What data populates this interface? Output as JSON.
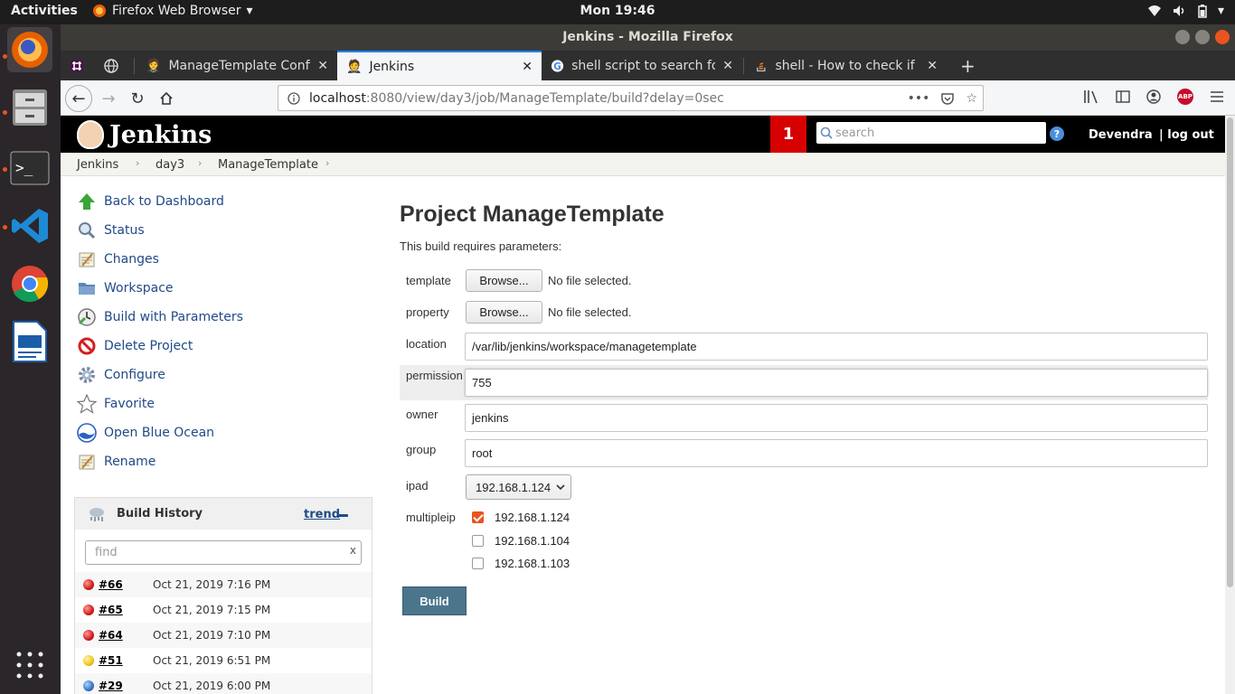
{
  "topbar": {
    "activities": "Activities",
    "app_name": "Firefox Web Browser",
    "clock": "Mon 19:46"
  },
  "window": {
    "title": "Jenkins - Mozilla Firefox"
  },
  "tabs": [
    {
      "label": "ManageTemplate Config",
      "icon": "jenkins-icon"
    },
    {
      "label": "Jenkins",
      "icon": "jenkins-icon"
    },
    {
      "label": "shell script to search for",
      "icon": "google-icon"
    },
    {
      "label": "shell - How to check if a f",
      "icon": "stackoverflow-icon"
    }
  ],
  "urlbar": {
    "host": "localhost",
    "path": ":8080/view/day3/job/ManageTemplate/build?delay=0sec"
  },
  "jenkins": {
    "brand": "Jenkins",
    "notification_count": "1",
    "search_placeholder": "search",
    "user": "Devendra",
    "logout": "| log out"
  },
  "breadcrumb": [
    "Jenkins",
    "day3",
    "ManageTemplate"
  ],
  "sidebar": {
    "tasks": [
      {
        "label": "Back to Dashboard",
        "icon": "up-arrow-icon"
      },
      {
        "label": "Status",
        "icon": "magnifier-icon"
      },
      {
        "label": "Changes",
        "icon": "notepad-icon"
      },
      {
        "label": "Workspace",
        "icon": "folder-icon"
      },
      {
        "label": "Build with Parameters",
        "icon": "clock-icon"
      },
      {
        "label": "Delete Project",
        "icon": "no-entry-icon"
      },
      {
        "label": "Configure",
        "icon": "gear-icon"
      },
      {
        "label": "Favorite",
        "icon": "star-icon"
      },
      {
        "label": "Open Blue Ocean",
        "icon": "blue-ocean-icon"
      },
      {
        "label": "Rename",
        "icon": "notepad-icon"
      }
    ]
  },
  "build_history": {
    "title": "Build History",
    "trend": "trend",
    "find_placeholder": "find",
    "clear": "x",
    "builds": [
      {
        "num": "#66",
        "date": "Oct 21, 2019 7:16 PM",
        "status": "red"
      },
      {
        "num": "#65",
        "date": "Oct 21, 2019 7:15 PM",
        "status": "red"
      },
      {
        "num": "#64",
        "date": "Oct 21, 2019 7:10 PM",
        "status": "red"
      },
      {
        "num": "#51",
        "date": "Oct 21, 2019 6:51 PM",
        "status": "yellow"
      },
      {
        "num": "#29",
        "date": "Oct 21, 2019 6:00 PM",
        "status": "blue"
      }
    ]
  },
  "main": {
    "title": "Project ManageTemplate",
    "requires": "This build requires parameters:",
    "params": {
      "template": {
        "label": "template",
        "button": "Browse...",
        "file": "No file selected."
      },
      "property": {
        "label": "property",
        "button": "Browse...",
        "file": "No file selected."
      },
      "location": {
        "label": "location",
        "value": "/var/lib/jenkins/workspace/managetemplate"
      },
      "permission": {
        "label": "permission",
        "value": "755"
      },
      "owner": {
        "label": "owner",
        "value": "jenkins"
      },
      "group": {
        "label": "group",
        "value": "root"
      },
      "ipad": {
        "label": "ipad",
        "selected": "192.168.1.124"
      },
      "multipleip": {
        "label": "multipleip",
        "options": [
          {
            "label": "192.168.1.124",
            "checked": true
          },
          {
            "label": "192.168.1.104",
            "checked": false
          },
          {
            "label": "192.168.1.103",
            "checked": false
          }
        ]
      }
    },
    "build_button": "Build"
  }
}
